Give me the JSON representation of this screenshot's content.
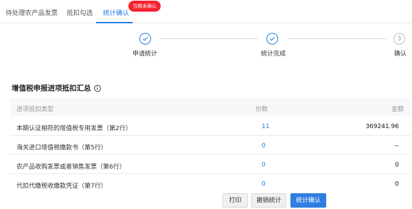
{
  "tabs": [
    {
      "label": "待处理农产品发票"
    },
    {
      "label": "抵扣勾选"
    },
    {
      "label": "统计确认"
    }
  ],
  "badge": "当期未确认",
  "steps": [
    {
      "label": "申请统计",
      "state": "done"
    },
    {
      "label": "统计完成",
      "state": "done"
    },
    {
      "label": "确认",
      "number": "3",
      "state": "pending"
    }
  ],
  "section": {
    "title": "增值税申报进项抵扣汇总"
  },
  "table": {
    "headers": [
      "进项抵扣类型",
      "份数",
      "金额"
    ],
    "rows": [
      {
        "type": "本期认证相符的增值税专用发票（第2行）",
        "count": "11",
        "amount": "369241.96"
      },
      {
        "type": "海关进口增值税缴款书（第5行）",
        "count": "0",
        "amount": "--"
      },
      {
        "type": "农产品收购发票或者销售发票（第6行）",
        "count": "0",
        "amount": "0"
      },
      {
        "type": "代扣代缴税收缴款凭证（第7行）",
        "count": "0",
        "amount": "0"
      }
    ]
  },
  "footer": {
    "print": "打印",
    "revoke": "撤销统计",
    "confirm": "统计确认"
  },
  "colors": {
    "accent": "#1f7ae0",
    "badge": "#f5222d"
  }
}
